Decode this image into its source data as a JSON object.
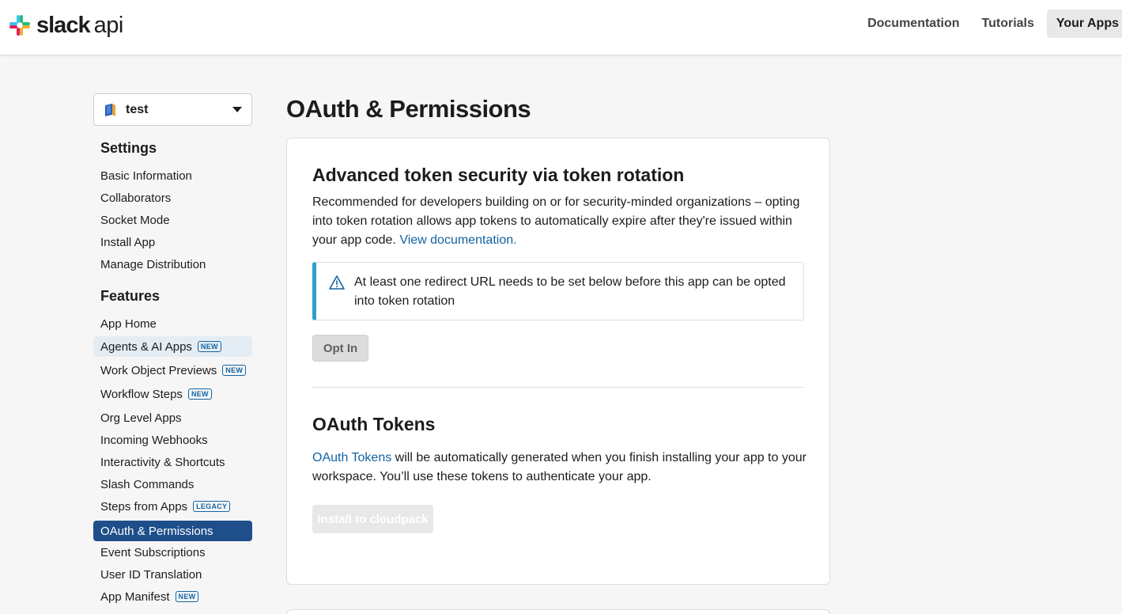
{
  "header": {
    "logo_slack": "slack",
    "logo_api": "api",
    "nav": [
      "Documentation",
      "Tutorials",
      "Your Apps"
    ]
  },
  "sidebar": {
    "app_name": "test",
    "settings_heading": "Settings",
    "settings_items": [
      "Basic Information",
      "Collaborators",
      "Socket Mode",
      "Install App",
      "Manage Distribution"
    ],
    "features_heading": "Features",
    "features_items": [
      {
        "label": "App Home",
        "tag": ""
      },
      {
        "label": "Agents & AI Apps",
        "tag": "NEW"
      },
      {
        "label": "Work Object Previews",
        "tag": "NEW"
      },
      {
        "label": "Workflow Steps",
        "tag": "NEW"
      },
      {
        "label": "Org Level Apps",
        "tag": ""
      },
      {
        "label": "Incoming Webhooks",
        "tag": ""
      },
      {
        "label": "Interactivity & Shortcuts",
        "tag": ""
      },
      {
        "label": "Slash Commands",
        "tag": ""
      },
      {
        "label": "Steps from Apps",
        "tag": "LEGACY"
      },
      {
        "label": "OAuth & Permissions",
        "tag": ""
      },
      {
        "label": "Event Subscriptions",
        "tag": ""
      },
      {
        "label": "User ID Translation",
        "tag": ""
      },
      {
        "label": "App Manifest",
        "tag": "NEW"
      }
    ]
  },
  "main": {
    "page_title": "OAuth & Permissions",
    "rotation": {
      "title": "Advanced token security via token rotation",
      "description": "Recommended for developers building on or for security-minded organizations – opting into token rotation allows app tokens to automatically expire after they're issued within your app code.",
      "link": "View documentation.",
      "alert": "At least one redirect URL needs to be set below before this app can be opted into token rotation",
      "button": "Opt In"
    },
    "tokens": {
      "title": "OAuth Tokens",
      "link": "OAuth Tokens",
      "description": "will be automatically generated when you finish installing your app to your workspace. You’ll use these tokens to authenticate your app.",
      "button": "Install to cloudpack"
    }
  },
  "colors": {
    "accent": "#1264a3",
    "active_nav": "#1e4f8b",
    "alert_bar": "#2ea0d0"
  }
}
